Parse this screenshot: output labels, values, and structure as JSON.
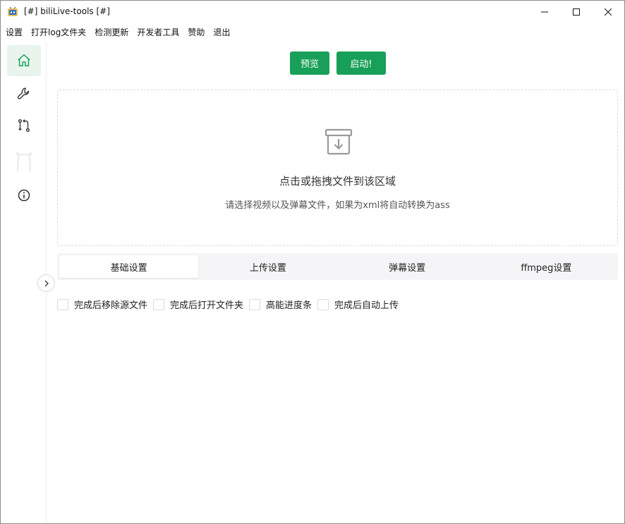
{
  "window": {
    "title": "[#] biliLive-tools [#]"
  },
  "menu": {
    "items": [
      "设置",
      "打开log文件夹",
      "检测更新",
      "开发者工具",
      "赞助",
      "退出"
    ]
  },
  "sidebar": {
    "items": [
      {
        "icon": "home-icon",
        "active": true
      },
      {
        "icon": "wrench-icon",
        "active": false
      },
      {
        "icon": "git-compare-icon",
        "active": false
      },
      {
        "icon": "cat-icon",
        "active": false
      },
      {
        "icon": "info-icon",
        "active": false
      }
    ]
  },
  "toolbar": {
    "preview_label": "预览",
    "start_label": "启动!"
  },
  "dropzone": {
    "title": "点击或拖拽文件到该区域",
    "hint": "请选择视频以及弹幕文件，如果为xml将自动转换为ass"
  },
  "tabs": [
    {
      "label": "基础设置",
      "active": true
    },
    {
      "label": "上传设置",
      "active": false
    },
    {
      "label": "弹幕设置",
      "active": false
    },
    {
      "label": "ffmpeg设置",
      "active": false
    }
  ],
  "options": [
    {
      "label": "完成后移除源文件",
      "checked": false
    },
    {
      "label": "完成后打开文件夹",
      "checked": false
    },
    {
      "label": "高能进度条",
      "checked": false
    },
    {
      "label": "完成后自动上传",
      "checked": false
    }
  ],
  "colors": {
    "accent": "#18a058",
    "active_bg": "#e8f4ec"
  }
}
